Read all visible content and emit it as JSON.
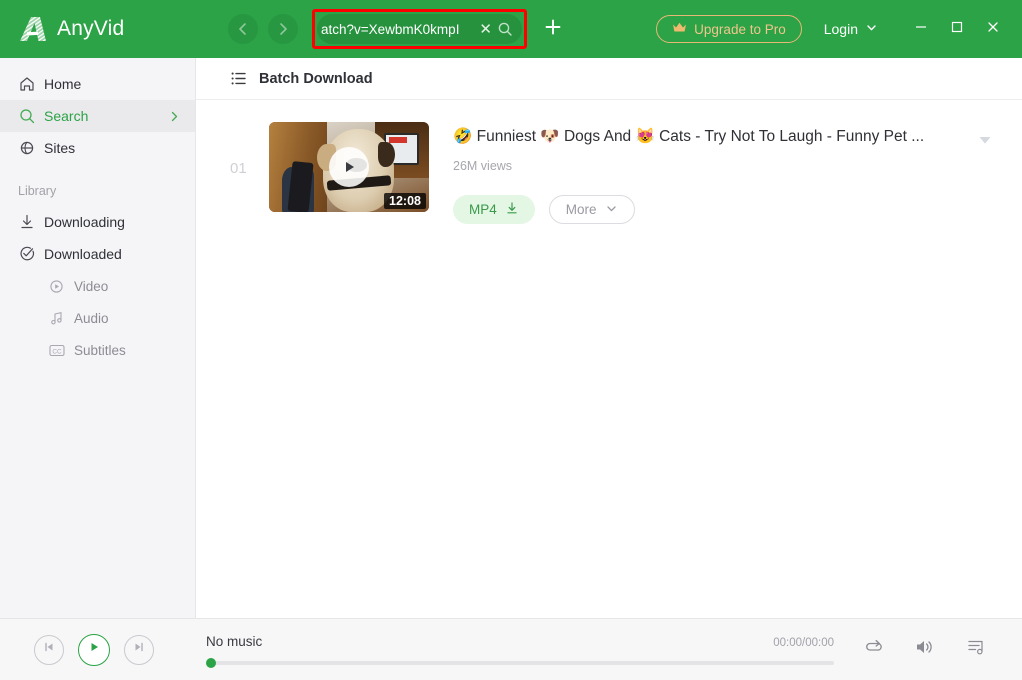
{
  "app": {
    "name": "AnyVid",
    "accent_green": "#2ba346",
    "highlight_red": "#ff0000",
    "gold": "#e8b877"
  },
  "header": {
    "logo_label": "AnyVid",
    "back_icon": "chevron-left-icon",
    "forward_icon": "chevron-right-icon",
    "search": {
      "value": "atch?v=XewbmK0kmpI",
      "placeholder": "Search or paste link",
      "clear_icon": "close-icon",
      "search_icon": "search-icon"
    },
    "add_tab_icon": "plus-icon",
    "upgrade_label": "Upgrade to Pro",
    "upgrade_icon": "crown-icon",
    "login_label": "Login",
    "login_chevron_icon": "chevron-down-icon",
    "minimize_icon": "minimize-icon",
    "maximize_icon": "maximize-icon",
    "close_icon": "close-icon"
  },
  "sidebar": {
    "items": [
      {
        "label": "Home",
        "icon": "home-icon",
        "active": false
      },
      {
        "label": "Search",
        "icon": "search-icon",
        "active": true
      },
      {
        "label": "Sites",
        "icon": "globe-icon",
        "active": false
      }
    ],
    "section_label": "Library",
    "library": [
      {
        "label": "Downloading",
        "icon": "download-icon"
      },
      {
        "label": "Downloaded",
        "icon": "check-circle-icon"
      }
    ],
    "sub_items": [
      {
        "label": "Video",
        "icon": "play-circle-icon"
      },
      {
        "label": "Audio",
        "icon": "music-note-icon"
      },
      {
        "label": "Subtitles",
        "icon": "closed-caption-icon"
      }
    ]
  },
  "main": {
    "header_icon": "list-icon",
    "header_title": "Batch Download",
    "results": [
      {
        "index": "01",
        "duration": "12:08",
        "title": "🤣 Funniest 🐶 Dogs And 😻 Cats - Try Not To Laugh - Funny Pet ...",
        "views": "26M views",
        "download_label": "MP4",
        "download_icon": "download-icon",
        "more_label": "More",
        "more_icon": "chevron-down-icon",
        "expand_icon": "caret-down-icon",
        "play_icon": "play-icon"
      }
    ]
  },
  "player": {
    "prev_icon": "skip-previous-icon",
    "play_icon": "play-icon",
    "next_icon": "skip-next-icon",
    "title": "No music",
    "time": "00:00/00:00",
    "progress_percent": 0,
    "repeat_icon": "repeat-icon",
    "volume_icon": "volume-icon",
    "playlist_icon": "playlist-icon"
  }
}
